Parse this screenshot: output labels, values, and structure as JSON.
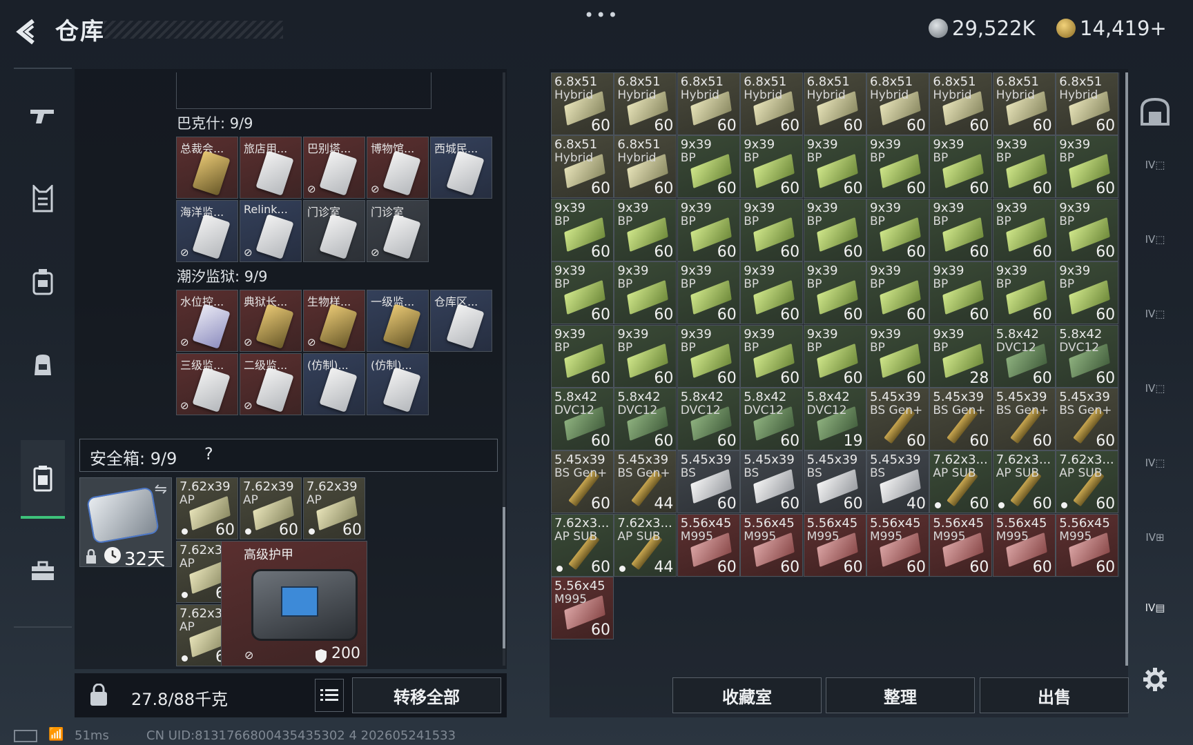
{
  "header": {
    "title": "仓库",
    "menu": "•••",
    "currency1": "29,522K",
    "currency2": "14,419+"
  },
  "nav": [
    "weapon-icon",
    "armor-vest-icon",
    "chest-rig-icon",
    "backpack-icon",
    "safe-container-icon",
    "briefcase-icon"
  ],
  "groups": [
    {
      "title": "巴克什: 9/9",
      "cards": [
        {
          "label": "总裁会...",
          "color": "red",
          "key": "gold",
          "nobag": false
        },
        {
          "label": "旅店用...",
          "color": "red",
          "key": "white",
          "nobag": false
        },
        {
          "label": "巴别塔...",
          "color": "red",
          "key": "white",
          "nobag": true
        },
        {
          "label": "博物馆...",
          "color": "red",
          "key": "white",
          "nobag": true
        },
        {
          "label": "西城民...",
          "color": "blue",
          "key": "white",
          "nobag": false
        },
        {
          "label": "海洋监...",
          "color": "blue",
          "key": "white",
          "nobag": true
        },
        {
          "label": "Relink...",
          "color": "blue",
          "key": "white",
          "nobag": true
        },
        {
          "label": "门诊室",
          "color": "gray",
          "key": "white",
          "nobag": false
        },
        {
          "label": "门诊室",
          "color": "gray",
          "key": "white",
          "nobag": true
        }
      ]
    },
    {
      "title": "潮汐监狱: 9/9",
      "cards": [
        {
          "label": "水位控...",
          "color": "red",
          "key": "purple",
          "nobag": true
        },
        {
          "label": "典狱长...",
          "color": "red",
          "key": "gold",
          "nobag": true
        },
        {
          "label": "生物样...",
          "color": "red",
          "key": "gold",
          "nobag": true
        },
        {
          "label": "一级监...",
          "color": "blue",
          "key": "gold",
          "nobag": false
        },
        {
          "label": "仓库区...",
          "color": "blue",
          "key": "white",
          "nobag": false
        },
        {
          "label": "三级监...",
          "color": "red",
          "key": "white",
          "nobag": true
        },
        {
          "label": "二级监...",
          "color": "red",
          "key": "white",
          "nobag": true
        },
        {
          "label": "(仿制)...",
          "color": "blue",
          "key": "white",
          "nobag": false
        },
        {
          "label": "(仿制)...",
          "color": "blue",
          "key": "white",
          "nobag": false
        }
      ]
    }
  ],
  "safe": {
    "label": "安全箱: 9/9",
    "help": "?",
    "time": "32天",
    "items": [
      {
        "t1": "7.62x39",
        "t2": "AP",
        "qty": "60"
      },
      {
        "t1": "7.62x39",
        "t2": "AP",
        "qty": "60"
      },
      {
        "t1": "7.62x39",
        "t2": "AP",
        "qty": "60"
      },
      {
        "t1": "7.62x39",
        "t2": "AP",
        "qty": "60"
      },
      {
        "t1": "7.62x39",
        "t2": "AP",
        "qty": "60"
      }
    ],
    "armor_label": "高级护甲",
    "armor_durability": "200"
  },
  "bottom": {
    "weight": "27.8/88千克",
    "transfer_all": "转移全部"
  },
  "ammo_grid": [
    {
      "t1": "6.8x51",
      "t2": "Hybrid",
      "qty": "60",
      "style": "tan"
    },
    {
      "t1": "6.8x51",
      "t2": "Hybrid",
      "qty": "60",
      "style": "tan"
    },
    {
      "t1": "6.8x51",
      "t2": "Hybrid",
      "qty": "60",
      "style": "tan"
    },
    {
      "t1": "6.8x51",
      "t2": "Hybrid",
      "qty": "60",
      "style": "tan"
    },
    {
      "t1": "6.8x51",
      "t2": "Hybrid",
      "qty": "60",
      "style": "tan"
    },
    {
      "t1": "6.8x51",
      "t2": "Hybrid",
      "qty": "60",
      "style": "tan"
    },
    {
      "t1": "6.8x51",
      "t2": "Hybrid",
      "qty": "60",
      "style": "tan"
    },
    {
      "t1": "6.8x51",
      "t2": "Hybrid",
      "qty": "60",
      "style": "tan"
    },
    {
      "t1": "6.8x51",
      "t2": "Hybrid",
      "qty": "60",
      "style": "tan"
    },
    {
      "t1": "6.8x51",
      "t2": "Hybrid",
      "qty": "60",
      "style": "tan"
    },
    {
      "t1": "6.8x51",
      "t2": "Hybrid",
      "qty": "60",
      "style": "tan"
    },
    {
      "t1": "9x39",
      "t2": "BP",
      "qty": "60",
      "style": "lime"
    },
    {
      "t1": "9x39",
      "t2": "BP",
      "qty": "60",
      "style": "lime"
    },
    {
      "t1": "9x39",
      "t2": "BP",
      "qty": "60",
      "style": "lime"
    },
    {
      "t1": "9x39",
      "t2": "BP",
      "qty": "60",
      "style": "lime"
    },
    {
      "t1": "9x39",
      "t2": "BP",
      "qty": "60",
      "style": "lime"
    },
    {
      "t1": "9x39",
      "t2": "BP",
      "qty": "60",
      "style": "lime"
    },
    {
      "t1": "9x39",
      "t2": "BP",
      "qty": "60",
      "style": "lime"
    },
    {
      "t1": "9x39",
      "t2": "BP",
      "qty": "60",
      "style": "lime"
    },
    {
      "t1": "9x39",
      "t2": "BP",
      "qty": "60",
      "style": "lime"
    },
    {
      "t1": "9x39",
      "t2": "BP",
      "qty": "60",
      "style": "lime"
    },
    {
      "t1": "9x39",
      "t2": "BP",
      "qty": "60",
      "style": "lime"
    },
    {
      "t1": "9x39",
      "t2": "BP",
      "qty": "60",
      "style": "lime"
    },
    {
      "t1": "9x39",
      "t2": "BP",
      "qty": "60",
      "style": "lime"
    },
    {
      "t1": "9x39",
      "t2": "BP",
      "qty": "60",
      "style": "lime"
    },
    {
      "t1": "9x39",
      "t2": "BP",
      "qty": "60",
      "style": "lime"
    },
    {
      "t1": "9x39",
      "t2": "BP",
      "qty": "60",
      "style": "lime"
    },
    {
      "t1": "9x39",
      "t2": "BP",
      "qty": "60",
      "style": "lime"
    },
    {
      "t1": "9x39",
      "t2": "BP",
      "qty": "60",
      "style": "lime"
    },
    {
      "t1": "9x39",
      "t2": "BP",
      "qty": "60",
      "style": "lime"
    },
    {
      "t1": "9x39",
      "t2": "BP",
      "qty": "60",
      "style": "lime"
    },
    {
      "t1": "9x39",
      "t2": "BP",
      "qty": "60",
      "style": "lime"
    },
    {
      "t1": "9x39",
      "t2": "BP",
      "qty": "60",
      "style": "lime"
    },
    {
      "t1": "9x39",
      "t2": "BP",
      "qty": "60",
      "style": "lime"
    },
    {
      "t1": "9x39",
      "t2": "BP",
      "qty": "60",
      "style": "lime"
    },
    {
      "t1": "9x39",
      "t2": "BP",
      "qty": "60",
      "style": "lime"
    },
    {
      "t1": "9x39",
      "t2": "BP",
      "qty": "60",
      "style": "lime"
    },
    {
      "t1": "9x39",
      "t2": "BP",
      "qty": "60",
      "style": "lime"
    },
    {
      "t1": "9x39",
      "t2": "BP",
      "qty": "60",
      "style": "lime"
    },
    {
      "t1": "9x39",
      "t2": "BP",
      "qty": "60",
      "style": "lime"
    },
    {
      "t1": "9x39",
      "t2": "BP",
      "qty": "60",
      "style": "lime"
    },
    {
      "t1": "9x39",
      "t2": "BP",
      "qty": "60",
      "style": "lime"
    },
    {
      "t1": "9x39",
      "t2": "BP",
      "qty": "28",
      "style": "lime"
    },
    {
      "t1": "5.8x42",
      "t2": "DVC12",
      "qty": "60",
      "style": "dgreen"
    },
    {
      "t1": "5.8x42",
      "t2": "DVC12",
      "qty": "60",
      "style": "dgreen"
    },
    {
      "t1": "5.8x42",
      "t2": "DVC12",
      "qty": "60",
      "style": "dgreen"
    },
    {
      "t1": "5.8x42",
      "t2": "DVC12",
      "qty": "60",
      "style": "dgreen"
    },
    {
      "t1": "5.8x42",
      "t2": "DVC12",
      "qty": "60",
      "style": "dgreen"
    },
    {
      "t1": "5.8x42",
      "t2": "DVC12",
      "qty": "60",
      "style": "dgreen"
    },
    {
      "t1": "5.8x42",
      "t2": "DVC12",
      "qty": "19",
      "style": "dgreen"
    },
    {
      "t1": "5.45x39",
      "t2": "BS Gen+",
      "qty": "60",
      "style": "bullet"
    },
    {
      "t1": "5.45x39",
      "t2": "BS Gen+",
      "qty": "60",
      "style": "bullet"
    },
    {
      "t1": "5.45x39",
      "t2": "BS Gen+",
      "qty": "60",
      "style": "bullet"
    },
    {
      "t1": "5.45x39",
      "t2": "BS Gen+",
      "qty": "60",
      "style": "bullet"
    },
    {
      "t1": "5.45x39",
      "t2": "BS Gen+",
      "qty": "60",
      "style": "bullet"
    },
    {
      "t1": "5.45x39",
      "t2": "BS Gen+",
      "qty": "44",
      "style": "bullet"
    },
    {
      "t1": "5.45x39",
      "t2": "BS",
      "qty": "60",
      "style": "silver"
    },
    {
      "t1": "5.45x39",
      "t2": "BS",
      "qty": "60",
      "style": "silver"
    },
    {
      "t1": "5.45x39",
      "t2": "BS",
      "qty": "60",
      "style": "silver"
    },
    {
      "t1": "5.45x39",
      "t2": "BS",
      "qty": "40",
      "style": "silver"
    },
    {
      "t1": "7.62x3...",
      "t2": "AP SUB",
      "qty": "60",
      "style": "bulletdot"
    },
    {
      "t1": "7.62x3...",
      "t2": "AP SUB",
      "qty": "60",
      "style": "bulletdot"
    },
    {
      "t1": "7.62x3...",
      "t2": "AP SUB",
      "qty": "60",
      "style": "bulletdot"
    },
    {
      "t1": "7.62x3...",
      "t2": "AP SUB",
      "qty": "60",
      "style": "bulletdot"
    },
    {
      "t1": "7.62x3...",
      "t2": "AP SUB",
      "qty": "44",
      "style": "bulletdot"
    },
    {
      "t1": "5.56x45",
      "t2": "M995",
      "qty": "60",
      "style": "pink"
    },
    {
      "t1": "5.56x45",
      "t2": "M995",
      "qty": "60",
      "style": "pink"
    },
    {
      "t1": "5.56x45",
      "t2": "M995",
      "qty": "60",
      "style": "pink"
    },
    {
      "t1": "5.56x45",
      "t2": "M995",
      "qty": "60",
      "style": "pink"
    },
    {
      "t1": "5.56x45",
      "t2": "M995",
      "qty": "60",
      "style": "pink"
    },
    {
      "t1": "5.56x45",
      "t2": "M995",
      "qty": "60",
      "style": "pink"
    },
    {
      "t1": "5.56x45",
      "t2": "M995",
      "qty": "60",
      "style": "pink"
    },
    {
      "t1": "5.56x45",
      "t2": "M995",
      "qty": "60",
      "style": "pink"
    }
  ],
  "actions": {
    "collection": "收藏室",
    "organize": "整理",
    "sell": "出售"
  },
  "status": {
    "ping": "51ms",
    "uid": "CN UID:8131766800435435302 4 202605241533"
  }
}
